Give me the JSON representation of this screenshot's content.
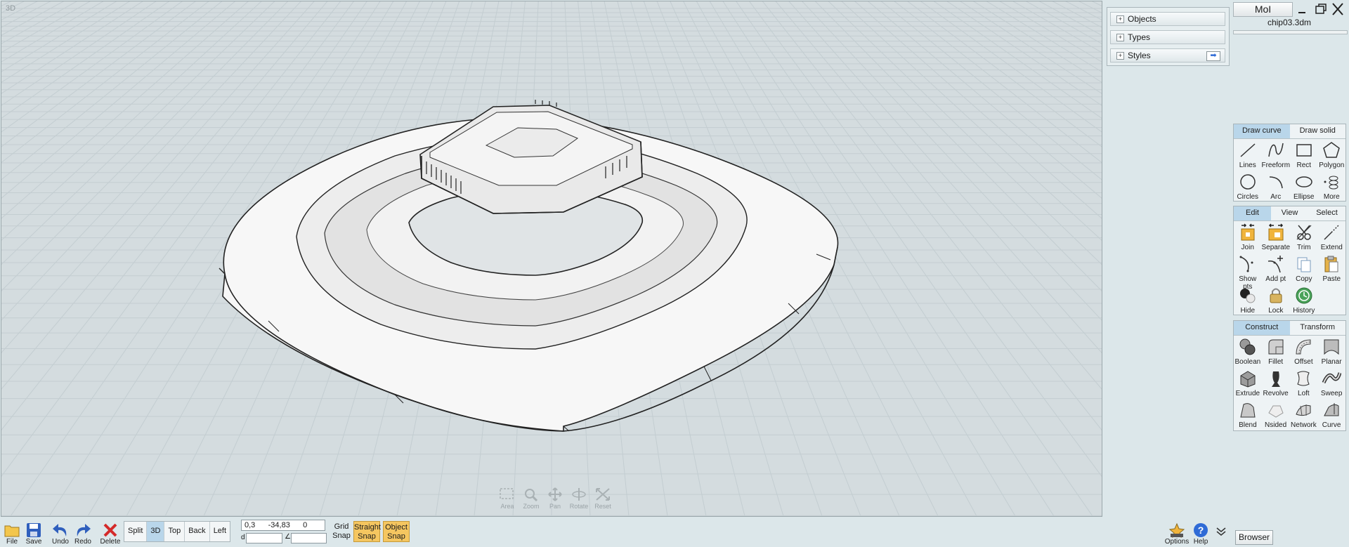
{
  "viewport": {
    "label": "3D",
    "nav": [
      {
        "id": "area",
        "label": "Area"
      },
      {
        "id": "zoom",
        "label": "Zoom"
      },
      {
        "id": "pan",
        "label": "Pan"
      },
      {
        "id": "rotate",
        "label": "Rotate"
      },
      {
        "id": "reset",
        "label": "Reset"
      }
    ]
  },
  "scene_browser": {
    "items": [
      {
        "label": "Objects"
      },
      {
        "label": "Types"
      },
      {
        "label": "Styles"
      }
    ]
  },
  "app": {
    "name": "MoI",
    "document": "chip03.3dm"
  },
  "palettes": {
    "draw": {
      "tabs": [
        {
          "label": "Draw curve",
          "active": true
        },
        {
          "label": "Draw solid",
          "active": false
        }
      ],
      "tools": [
        {
          "label": "Lines",
          "icon": "line-icon"
        },
        {
          "label": "Freeform",
          "icon": "freeform-icon"
        },
        {
          "label": "Rect",
          "icon": "rect-icon"
        },
        {
          "label": "Polygon",
          "icon": "polygon-icon"
        },
        {
          "label": "Circles",
          "icon": "circle-icon"
        },
        {
          "label": "Arc",
          "icon": "arc-icon"
        },
        {
          "label": "Ellipse",
          "icon": "ellipse-icon"
        },
        {
          "label": "More",
          "icon": "more-icon"
        }
      ]
    },
    "edit": {
      "tabs": [
        {
          "label": "Edit",
          "active": true
        },
        {
          "label": "View",
          "active": false
        },
        {
          "label": "Select",
          "active": false
        }
      ],
      "tools": [
        {
          "label": "Join",
          "icon": "join-icon"
        },
        {
          "label": "Separate",
          "icon": "separate-icon"
        },
        {
          "label": "Trim",
          "icon": "trim-icon"
        },
        {
          "label": "Extend",
          "icon": "extend-icon"
        },
        {
          "label": "Show pts",
          "icon": "show-points-icon"
        },
        {
          "label": "Add pt",
          "icon": "add-point-icon"
        },
        {
          "label": "Copy",
          "icon": "copy-icon"
        },
        {
          "label": "Paste",
          "icon": "paste-icon"
        },
        {
          "label": "Hide",
          "icon": "hide-icon"
        },
        {
          "label": "Lock",
          "icon": "lock-icon"
        },
        {
          "label": "History",
          "icon": "history-icon"
        }
      ]
    },
    "construct": {
      "tabs": [
        {
          "label": "Construct",
          "active": true
        },
        {
          "label": "Transform",
          "active": false
        }
      ],
      "tools": [
        {
          "label": "Boolean",
          "icon": "boolean-icon"
        },
        {
          "label": "Fillet",
          "icon": "fillet-icon"
        },
        {
          "label": "Offset",
          "icon": "offset-icon"
        },
        {
          "label": "Planar",
          "icon": "planar-icon"
        },
        {
          "label": "Extrude",
          "icon": "extrude-icon"
        },
        {
          "label": "Revolve",
          "icon": "revolve-icon"
        },
        {
          "label": "Loft",
          "icon": "loft-icon"
        },
        {
          "label": "Sweep",
          "icon": "sweep-icon"
        },
        {
          "label": "Blend",
          "icon": "blend-icon"
        },
        {
          "label": "Nsided",
          "icon": "nsided-icon"
        },
        {
          "label": "Network",
          "icon": "network-icon"
        },
        {
          "label": "Curve",
          "icon": "curve-icon"
        }
      ]
    }
  },
  "bottom": {
    "file": "File",
    "save": "Save",
    "undo": "Undo",
    "redo": "Redo",
    "delete": "Delete",
    "views": [
      {
        "label": "Split",
        "active": false
      },
      {
        "label": "3D",
        "active": true
      },
      {
        "label": "Top",
        "active": false
      },
      {
        "label": "Back",
        "active": false
      },
      {
        "label": "Left",
        "active": false
      }
    ],
    "coords": "0,3      -34,83      0",
    "coord_d": "d",
    "coord_angle": "∠",
    "grid_snap": [
      "Grid",
      "Snap"
    ],
    "straight_snap": [
      "Straight",
      "Snap"
    ],
    "object_snap": [
      "Object",
      "Snap"
    ],
    "options": "Options",
    "help": "Help",
    "browser": "Browser"
  },
  "colors": {
    "accent_tab": "#b9d6ea",
    "snap_on": "#f5c660",
    "viewport_bg": "#d4dcdf"
  }
}
